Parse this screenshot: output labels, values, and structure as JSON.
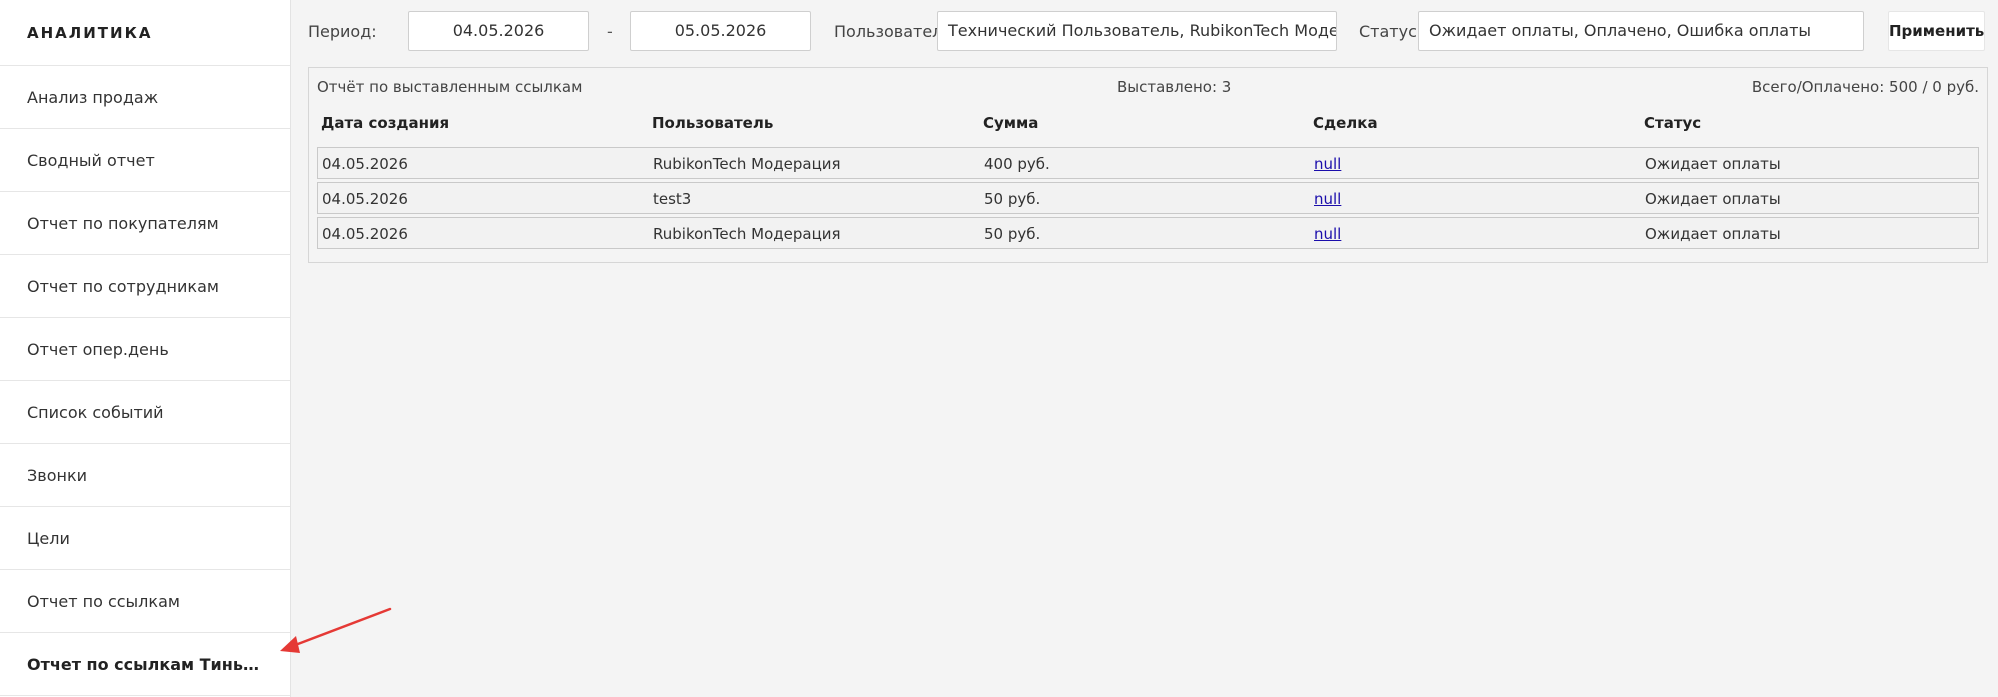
{
  "sidebar": {
    "title": "АНАЛИТИКА",
    "items": [
      {
        "label": "Анализ продаж"
      },
      {
        "label": "Сводный отчет"
      },
      {
        "label": "Отчет по покупателям"
      },
      {
        "label": "Отчет по сотрудникам"
      },
      {
        "label": "Отчет опер.день"
      },
      {
        "label": "Список событий"
      },
      {
        "label": "Звонки"
      },
      {
        "label": "Цели"
      },
      {
        "label": "Отчет по ссылкам"
      },
      {
        "label": "Отчет по ссылкам Тинькофф.Э..."
      }
    ]
  },
  "filters": {
    "period_label": "Период:",
    "date_from": "04.05.2026",
    "dash": "-",
    "date_to": "05.05.2026",
    "users_label": "Пользователи",
    "users_value": "Технический Пользователь, RubikonTech Модерация",
    "statuses_label": "Статусы",
    "statuses_value": "Ожидает оплаты, Оплачено, Ошибка оплаты",
    "apply_label": "Применить"
  },
  "report": {
    "title": "Отчёт по выставленным ссылкам",
    "issued": "Выставлено: 3",
    "total": "Всего/Оплачено: 500 / 0 руб.",
    "columns": [
      "Дата создания",
      "Пользователь",
      "Сумма",
      "Сделка",
      "Статус"
    ],
    "rows": [
      [
        "04.05.2026",
        "RubikonTech Модерация",
        "400 руб.",
        "null",
        "Ожидает оплаты"
      ],
      [
        "04.05.2026",
        "test3",
        "50 руб.",
        "null",
        "Ожидает оплаты"
      ],
      [
        "04.05.2026",
        "RubikonTech Модерация",
        "50 руб.",
        "null",
        "Ожидает оплаты"
      ]
    ]
  },
  "colors": {
    "accent_arrow": "#e53935",
    "link": "#1a0dab"
  }
}
